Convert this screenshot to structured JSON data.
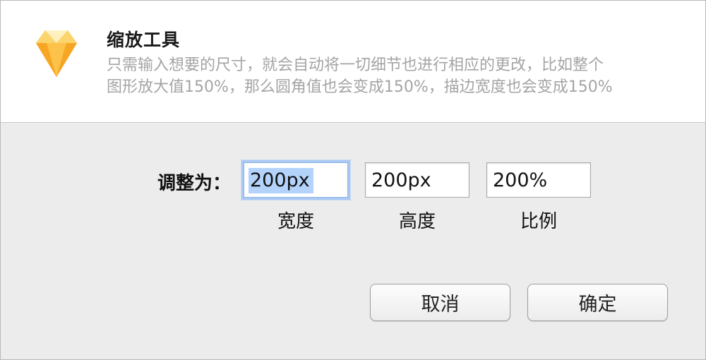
{
  "header": {
    "title": "缩放工具",
    "desc_line1": "只需输入想要的尺寸，就会自动将一切细节也进行相应的更改，比如整个",
    "desc_line2": "图形放大值150%，那么圆角值也会变成150%，描边宽度也会变成150%",
    "logo_icon": "sketch-diamond-icon"
  },
  "form": {
    "label": "调整为：",
    "width_value": "200px",
    "height_value": "200px",
    "scale_value": "200%",
    "width_caption": "宽度",
    "height_caption": "高度",
    "scale_caption": "比例"
  },
  "buttons": {
    "cancel": "取消",
    "ok": "确定"
  },
  "colors": {
    "focus_ring": "#a9c8f2",
    "selection": "#b3d3fb",
    "description_text": "#a4a4a4"
  }
}
